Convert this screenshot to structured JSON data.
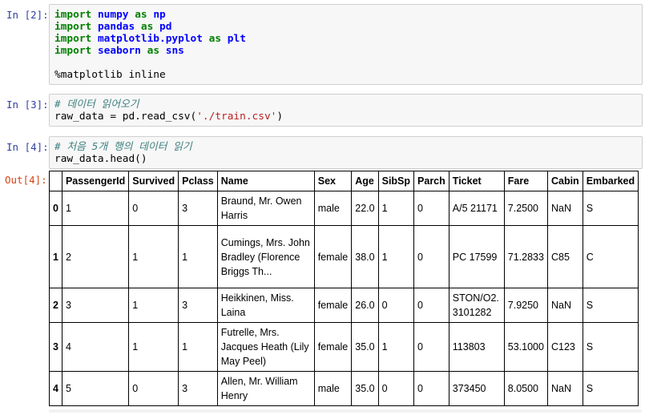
{
  "cells": [
    {
      "prompt": "In [2]:",
      "lines": [
        [
          {
            "t": "import",
            "c": "kw"
          },
          {
            "t": " ",
            "c": "plain"
          },
          {
            "t": "numpy",
            "c": "mod"
          },
          {
            "t": " ",
            "c": "plain"
          },
          {
            "t": "as",
            "c": "kw"
          },
          {
            "t": " ",
            "c": "plain"
          },
          {
            "t": "np",
            "c": "mod"
          }
        ],
        [
          {
            "t": "import",
            "c": "kw"
          },
          {
            "t": " ",
            "c": "plain"
          },
          {
            "t": "pandas",
            "c": "mod"
          },
          {
            "t": " ",
            "c": "plain"
          },
          {
            "t": "as",
            "c": "kw"
          },
          {
            "t": " ",
            "c": "plain"
          },
          {
            "t": "pd",
            "c": "mod"
          }
        ],
        [
          {
            "t": "import",
            "c": "kw"
          },
          {
            "t": " ",
            "c": "plain"
          },
          {
            "t": "matplotlib.pyplot",
            "c": "mod"
          },
          {
            "t": " ",
            "c": "plain"
          },
          {
            "t": "as",
            "c": "kw"
          },
          {
            "t": " ",
            "c": "plain"
          },
          {
            "t": "plt",
            "c": "mod"
          }
        ],
        [
          {
            "t": "import",
            "c": "kw"
          },
          {
            "t": " ",
            "c": "plain"
          },
          {
            "t": "seaborn",
            "c": "mod"
          },
          {
            "t": " ",
            "c": "plain"
          },
          {
            "t": "as",
            "c": "kw"
          },
          {
            "t": " ",
            "c": "plain"
          },
          {
            "t": "sns",
            "c": "mod"
          }
        ],
        [],
        [
          {
            "t": "%matplotlib inline",
            "c": "plain"
          }
        ]
      ]
    },
    {
      "prompt": "In [3]:",
      "lines": [
        [
          {
            "t": "# 데이터 읽어오기",
            "c": "cm"
          }
        ],
        [
          {
            "t": "raw_data = pd.read_csv(",
            "c": "plain"
          },
          {
            "t": "'./train.csv'",
            "c": "str"
          },
          {
            "t": ")",
            "c": "plain"
          }
        ]
      ]
    },
    {
      "prompt": "In [4]:",
      "lines": [
        [
          {
            "t": "# 처음 5개 행의 데이터 읽기",
            "c": "cm"
          }
        ],
        [
          {
            "t": "raw_data.head()",
            "c": "plain"
          }
        ]
      ]
    }
  ],
  "output": {
    "prompt": "Out[4]:",
    "columns": [
      "PassengerId",
      "Survived",
      "Pclass",
      "Name",
      "Sex",
      "Age",
      "SibSp",
      "Parch",
      "Ticket",
      "Fare",
      "Cabin",
      "Embarked"
    ],
    "rows": [
      {
        "index": "0",
        "cells": [
          "1",
          "0",
          "3",
          "Braund, Mr. Owen Harris",
          "male",
          "22.0",
          "1",
          "0",
          "A/5 21171",
          "7.2500",
          "NaN",
          "S"
        ]
      },
      {
        "index": "1",
        "cells": [
          "2",
          "1",
          "1",
          "Cumings, Mrs. John Bradley (Florence Briggs Th...",
          "female",
          "38.0",
          "1",
          "0",
          "PC 17599",
          "71.2833",
          "C85",
          "C"
        ]
      },
      {
        "index": "2",
        "cells": [
          "3",
          "1",
          "3",
          "Heikkinen, Miss. Laina",
          "female",
          "26.0",
          "0",
          "0",
          "STON/O2. 3101282",
          "7.9250",
          "NaN",
          "S"
        ]
      },
      {
        "index": "3",
        "cells": [
          "4",
          "1",
          "1",
          "Futrelle, Mrs. Jacques Heath (Lily May Peel)",
          "female",
          "35.0",
          "1",
          "0",
          "113803",
          "53.1000",
          "C123",
          "S"
        ]
      },
      {
        "index": "4",
        "cells": [
          "5",
          "0",
          "3",
          "Allen, Mr. William Henry",
          "male",
          "35.0",
          "0",
          "0",
          "373450",
          "8.0500",
          "NaN",
          "S"
        ]
      }
    ]
  }
}
